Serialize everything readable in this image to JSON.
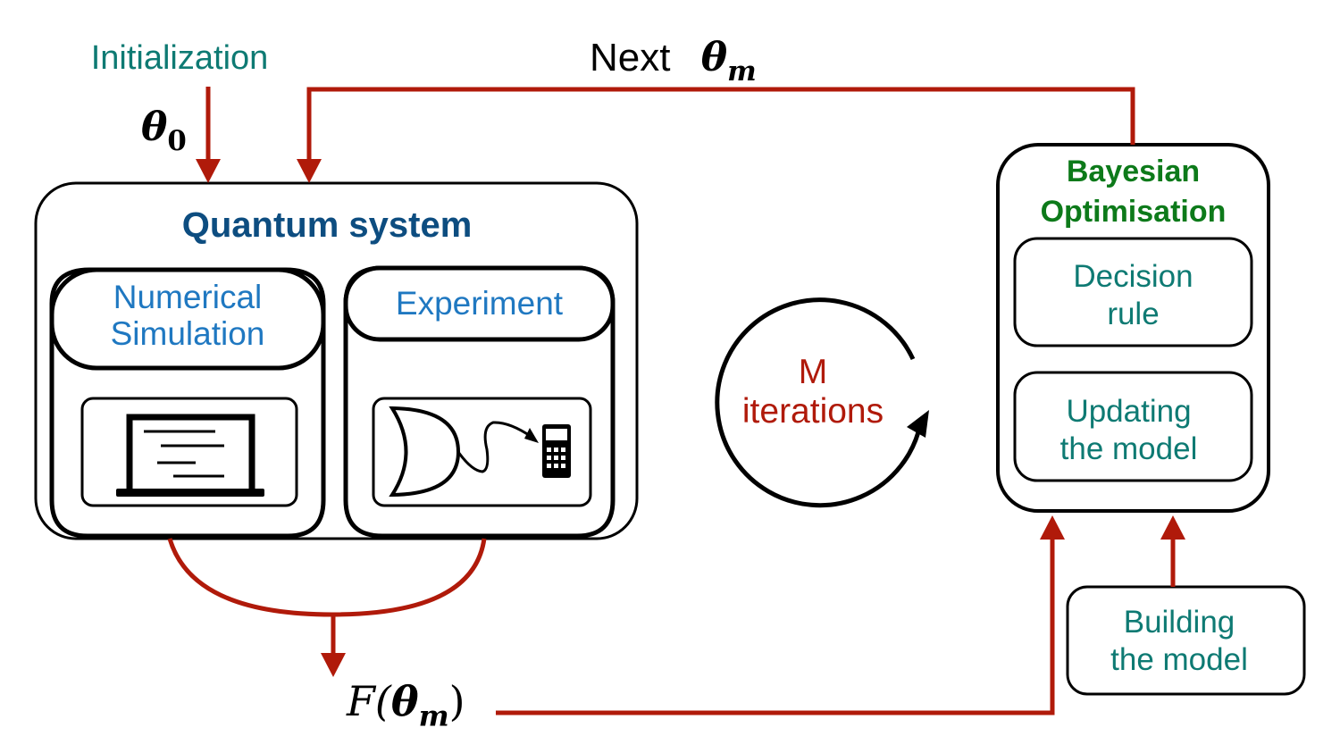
{
  "labels": {
    "initialization": "Initialization",
    "theta0_symbol": "θ",
    "theta0_subscript": "0",
    "next_word": "Next",
    "next_theta_symbol": "θ",
    "next_theta_subscript": "m",
    "output_function": "F(",
    "output_theta_symbol": "θ",
    "output_theta_subscript": "m",
    "output_close": ")"
  },
  "quantum_system": {
    "title": "Quantum system",
    "numerical_simulation": {
      "line1": "Numerical",
      "line2": "Simulation",
      "icon": "laptop-icon"
    },
    "experiment": {
      "label": "Experiment",
      "icon": "detector-calculator-icon"
    }
  },
  "loop": {
    "line1": "M",
    "line2": "iterations",
    "icon": "cycle-arrow-icon"
  },
  "bayesian": {
    "title_line1": "Bayesian",
    "title_line2": "Optimisation",
    "decision_rule": {
      "line1": "Decision",
      "line2": "rule"
    },
    "updating_model": {
      "line1": "Updating",
      "line2": "the model"
    }
  },
  "building_model": {
    "line1": "Building",
    "line2": "the model"
  },
  "colors": {
    "arrow_red": "#b01a0a",
    "teal_text": "#0e7a73",
    "blue_text": "#1f78c1",
    "navy_title": "#0d4d80",
    "green_title": "#0d7a1a"
  }
}
